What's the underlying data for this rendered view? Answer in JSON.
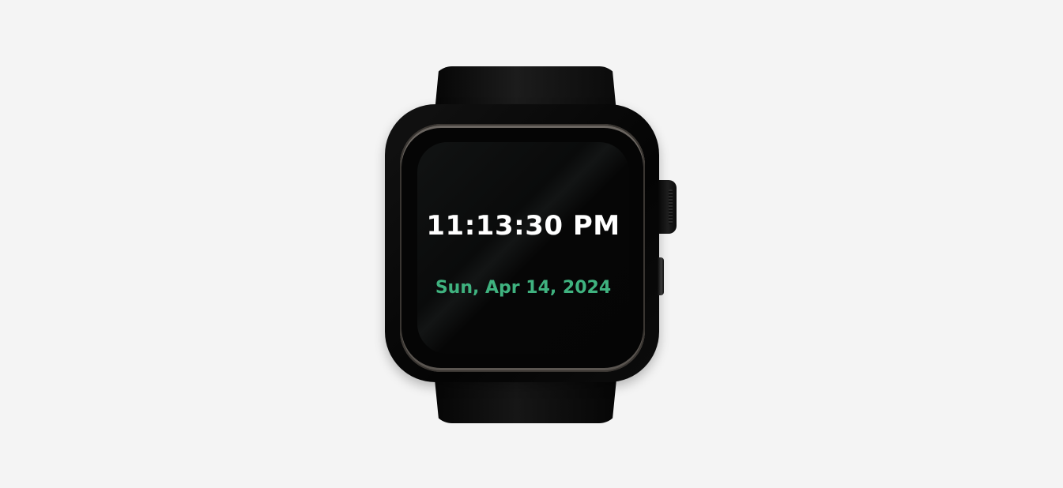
{
  "watch": {
    "time": "11:13:30 PM",
    "date": "Sun, Apr 14, 2024"
  },
  "colors": {
    "background": "#f4f4f4",
    "time_text": "#ffffff",
    "date_text": "#3fb27f",
    "watch_body": "#050505"
  },
  "icons": {
    "crown": "digital-crown",
    "side_button": "side-button"
  }
}
